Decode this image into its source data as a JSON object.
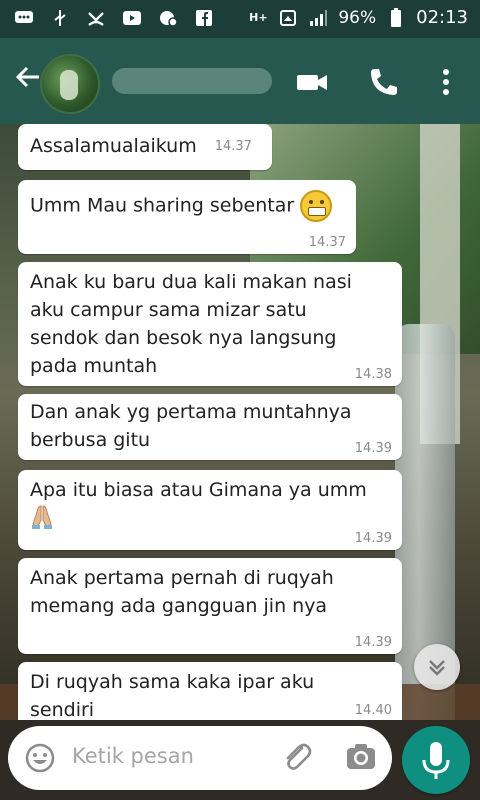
{
  "status_bar": {
    "battery": "96%",
    "time": "02:13",
    "network": "H+",
    "icons": [
      "chat-icon",
      "usb-icon",
      "missed-call-icon",
      "youtube-icon",
      "cloud-icon",
      "facebook-icon",
      "notification-icon",
      "signal-icon",
      "battery-icon"
    ]
  },
  "header": {
    "contact_name": "",
    "icons": [
      "back-arrow-icon",
      "video-call-icon",
      "voice-call-icon",
      "more-options-icon"
    ]
  },
  "messages": [
    {
      "text": "Assalamualaikum",
      "time": "14.37"
    },
    {
      "text": "Umm Mau sharing sebentar",
      "emoji": "grimacing-face-emoji",
      "time": "14.37"
    },
    {
      "text": "Anak ku baru dua kali makan nasi aku campur sama mizar satu sendok dan besok nya langsung pada muntah",
      "time": "14.38"
    },
    {
      "text": "Dan anak yg pertama muntahnya berbusa gitu",
      "time": "14.39"
    },
    {
      "text": "Apa itu biasa atau Gimana ya umm",
      "emoji": "folded-hands-emoji",
      "time": "14.39"
    },
    {
      "text": "Anak pertama pernah di ruqyah memang ada gangguan jin nya",
      "time": "14.39"
    },
    {
      "text": "Di ruqyah sama kaka ipar aku sendiri",
      "time": "14.40"
    }
  ],
  "composer": {
    "placeholder": "Ketik pesan",
    "icons": [
      "emoji-icon",
      "attach-icon",
      "camera-icon",
      "mic-icon"
    ]
  },
  "colors": {
    "status_bar": "#1c3d38",
    "app_bar": "#27584f",
    "mic_button": "#0e8f80",
    "bubble": "#ffffff"
  }
}
